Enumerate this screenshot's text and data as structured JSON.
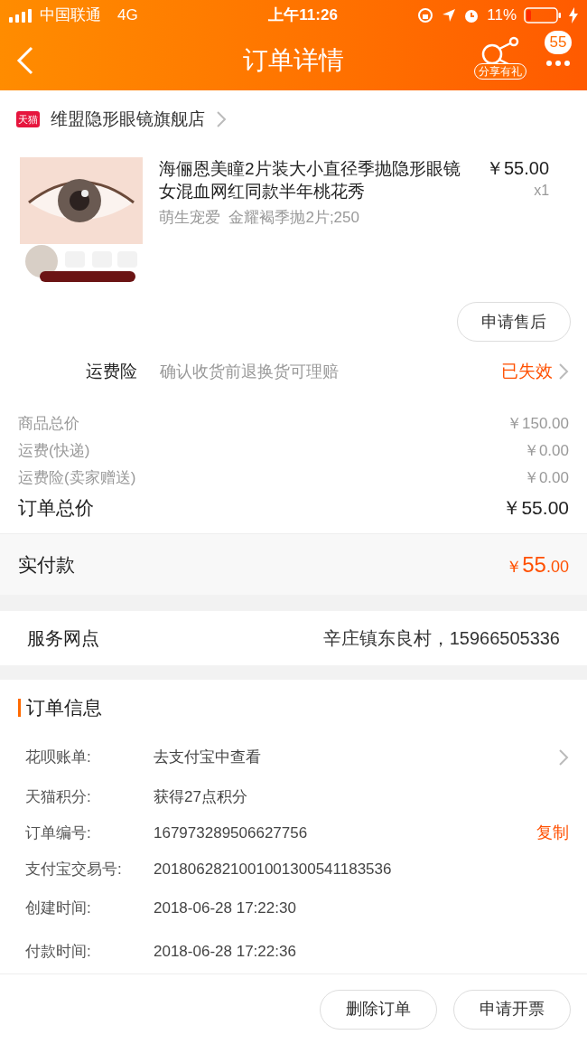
{
  "status_bar": {
    "carrier": "中国联通",
    "network": "4G",
    "time": "上午11:26",
    "battery": "11%"
  },
  "header": {
    "title": "订单详情",
    "share_label": "分享有礼",
    "badge": "55"
  },
  "shop": {
    "logo_text": "天猫",
    "name": "维盟隐形眼镜旗舰店"
  },
  "product": {
    "title": "海俪恩美瞳2片装大小直径季抛隐形眼镜女混血网红同款半年桃花秀",
    "price": "￥55.00",
    "quantity": "x1",
    "spec": "萌生宠爱  金耀褐季抛2片;250"
  },
  "aftersale_button": "申请售后",
  "freight_insurance": {
    "label": "运费险",
    "description": "确认收货前退换货可理赔",
    "status": "已失效"
  },
  "price_summary": [
    {
      "label": "商品总价",
      "value": "￥150.00",
      "kind": "minor"
    },
    {
      "label": "运费(快递)",
      "value": "￥0.00",
      "kind": "minor"
    },
    {
      "label": "运费险(卖家赠送)",
      "value": "￥0.00",
      "kind": "minor"
    },
    {
      "label": "订单总价",
      "value": "￥55.00",
      "kind": "total"
    }
  ],
  "paid": {
    "label": "实付款",
    "currency": "￥",
    "integer": "55",
    "decimal": ".00"
  },
  "service_point": {
    "label": "服务网点",
    "value": "辛庄镇东良村，15966505336"
  },
  "order_info": {
    "title": "订单信息",
    "rows": [
      {
        "label": "花呗账单:",
        "value": "去支付宝中查看",
        "kind": "link"
      },
      {
        "label": "天猫积分:",
        "value": "获得27点积分"
      },
      {
        "label": "订单编号:",
        "value": "167973289506627756",
        "kind": "copyable",
        "copy_text": "复制"
      },
      {
        "label": "支付宝交易号:",
        "value": "2018062821001001300541183536"
      },
      {
        "label": "创建时间:",
        "value": "2018-06-28 17:22:30"
      },
      {
        "label": "付款时间:",
        "value": "2018-06-28 17:22:36"
      }
    ]
  },
  "bottom_buttons": [
    "删除订单",
    "申请开票"
  ]
}
